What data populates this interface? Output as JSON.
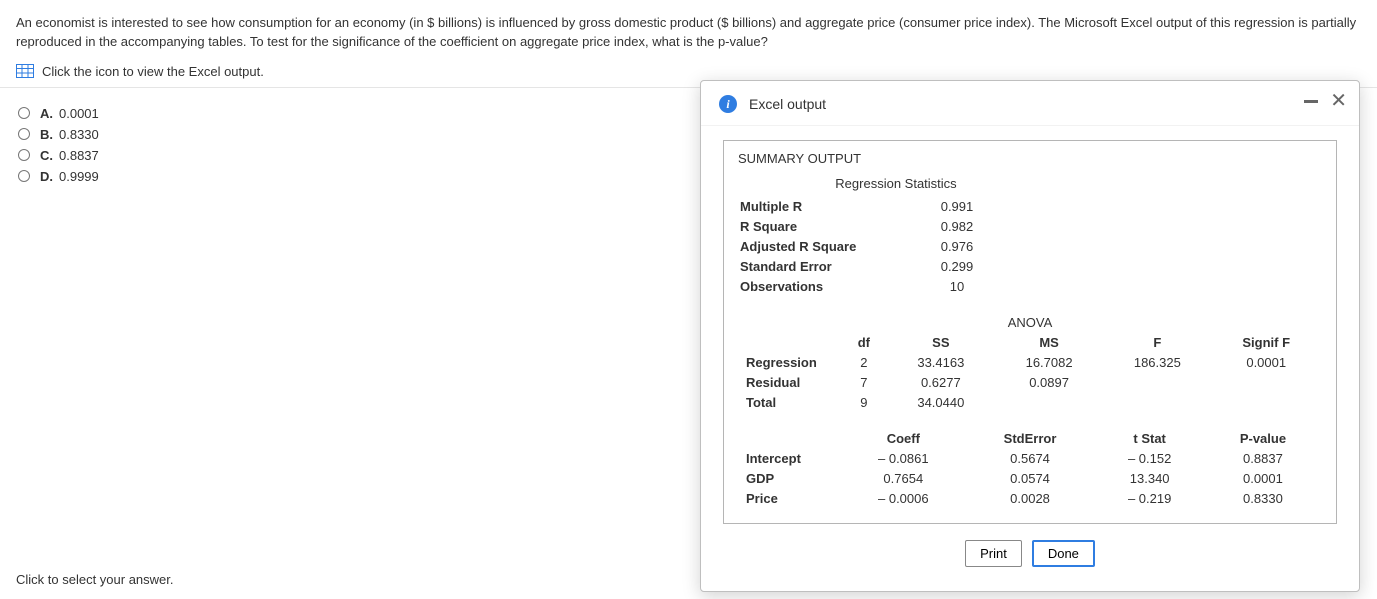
{
  "question": "An economist is interested to see how consumption for an economy (in $ billions) is influenced by gross domestic product ($ billions) and aggregate price (consumer price index). The Microsoft Excel output of this regression is partially reproduced in the accompanying tables. To test for the significance of the coefficient on aggregate price index, what is the p-value?",
  "view_link": "Click the icon to view the Excel output.",
  "options": [
    {
      "letter": "A.",
      "value": "0.0001"
    },
    {
      "letter": "B.",
      "value": "0.8330"
    },
    {
      "letter": "C.",
      "value": "0.8837"
    },
    {
      "letter": "D.",
      "value": "0.9999"
    }
  ],
  "footer": "Click to select your answer.",
  "modal": {
    "title": "Excel output",
    "summary_title": "SUMMARY OUTPUT",
    "reg_stats_title": "Regression Statistics",
    "reg_stats": [
      {
        "label": "Multiple R",
        "value": "0.991"
      },
      {
        "label": "R Square",
        "value": "0.982"
      },
      {
        "label": "Adjusted R Square",
        "value": "0.976"
      },
      {
        "label": "Standard Error",
        "value": "0.299"
      },
      {
        "label": "Observations",
        "value": "10"
      }
    ],
    "anova_title": "ANOVA",
    "anova_headers": [
      "",
      "df",
      "SS",
      "MS",
      "F",
      "Signif F"
    ],
    "anova_rows": [
      {
        "label": "Regression",
        "df": "2",
        "ss": "33.4163",
        "ms": "16.7082",
        "f": "186.325",
        "sig": "0.0001"
      },
      {
        "label": "Residual",
        "df": "7",
        "ss": "0.6277",
        "ms": "0.0897",
        "f": "",
        "sig": ""
      },
      {
        "label": "Total",
        "df": "9",
        "ss": "34.0440",
        "ms": "",
        "f": "",
        "sig": ""
      }
    ],
    "coef_headers": [
      "",
      "Coeff",
      "StdError",
      "t Stat",
      "P-value"
    ],
    "coef_rows": [
      {
        "label": "Intercept",
        "coef": "– 0.0861",
        "se": "0.5674",
        "t": "– 0.152",
        "p": "0.8837"
      },
      {
        "label": "GDP",
        "coef": "0.7654",
        "se": "0.0574",
        "t": "13.340",
        "p": "0.0001"
      },
      {
        "label": "Price",
        "coef": "– 0.0006",
        "se": "0.0028",
        "t": "– 0.219",
        "p": "0.8330"
      }
    ],
    "buttons": {
      "print": "Print",
      "done": "Done"
    }
  }
}
